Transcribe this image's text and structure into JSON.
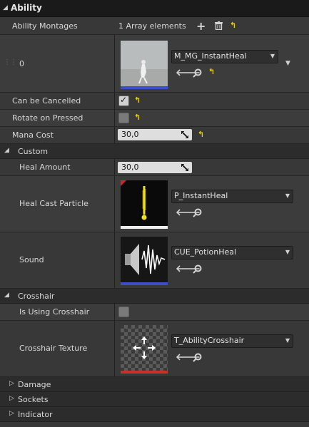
{
  "header": {
    "title": "Ability"
  },
  "montages": {
    "label": "Ability Montages",
    "count_text": "1 Array elements",
    "element_index": "0",
    "asset_name": "M_MG_InstantHeal"
  },
  "flags": {
    "cancel_label": "Can be Cancelled",
    "cancel_checked": true,
    "rotate_label": "Rotate on Pressed",
    "rotate_checked": false
  },
  "mana": {
    "label": "Mana Cost",
    "value": "30,0"
  },
  "custom": {
    "title": "Custom",
    "heal_amount_label": "Heal Amount",
    "heal_amount_value": "30,0",
    "particle_label": "Heal Cast Particle",
    "particle_asset": "P_InstantHeal",
    "sound_label": "Sound",
    "sound_asset": "CUE_PotionHeal"
  },
  "crosshair": {
    "title": "Crosshair",
    "using_label": "Is Using Crosshair",
    "using_checked": false,
    "texture_label": "Crosshair Texture",
    "texture_asset": "T_AbilityCrosshair"
  },
  "collapsed_sections": [
    "Damage",
    "Sockets",
    "Indicator"
  ],
  "colors": {
    "reset_arrow": "#e6d200",
    "montage_bar": "#3a4fc8",
    "texture_bar": "#c8302a",
    "particle_glow": "#f2e21a"
  }
}
